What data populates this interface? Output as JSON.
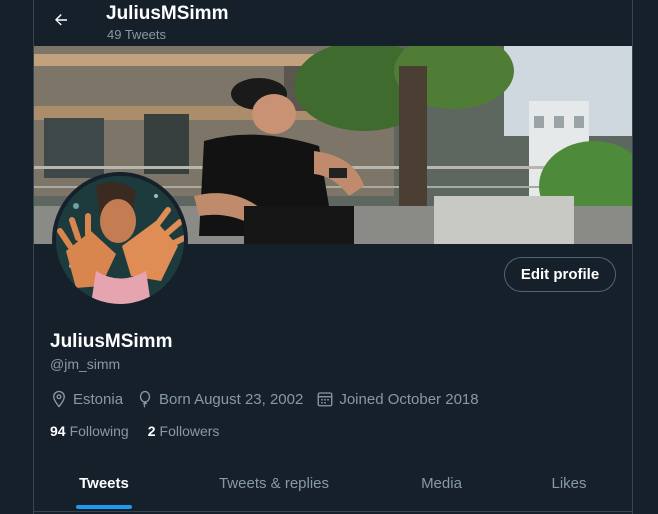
{
  "header": {
    "title": "JuliusMSimm",
    "subtitle": "49 Tweets",
    "back_icon": "arrow-left-icon"
  },
  "profile": {
    "display_name": "JuliusMSimm",
    "handle": "@jm_simm",
    "edit_label": "Edit profile",
    "location": "Estonia",
    "birthday": "Born August 23, 2002",
    "joined": "Joined October 2018",
    "following_count": "94",
    "following_label": "Following",
    "followers_count": "2",
    "followers_label": "Followers"
  },
  "tabs": [
    {
      "label": "Tweets",
      "active": true
    },
    {
      "label": "Tweets & replies",
      "active": false
    },
    {
      "label": "Media",
      "active": false
    },
    {
      "label": "Likes",
      "active": false
    }
  ],
  "colors": {
    "background": "#15202b",
    "accent": "#1d9bf0",
    "muted_text": "#8899a6",
    "border": "#38444d"
  }
}
